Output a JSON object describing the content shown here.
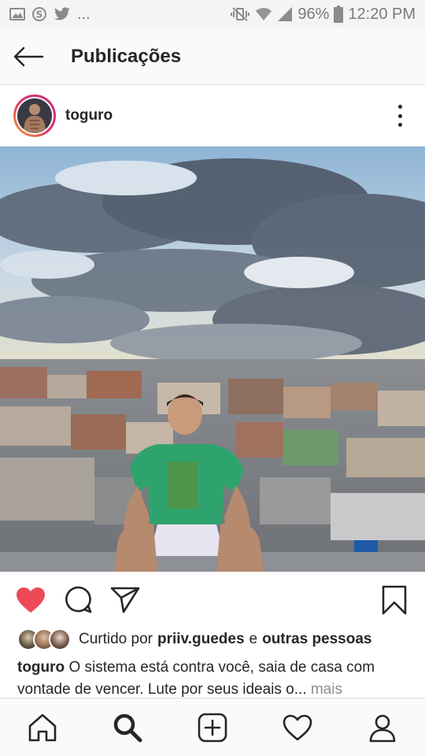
{
  "status_bar": {
    "notification_icons": [
      "image-icon",
      "skype-icon",
      "twitter-icon"
    ],
    "overflow_text": "...",
    "battery": "96%",
    "time": "12:20 PM"
  },
  "header": {
    "title": "Publicações"
  },
  "post": {
    "username": "toguro",
    "liked": true,
    "likes": {
      "prefix": "Curtido por",
      "user": "priiv.guedes",
      "conjunction": "e",
      "others": "outras pessoas"
    },
    "caption": {
      "username": "toguro",
      "text": "O sistema está contra você, saia de casa com vontade de vencer. Lute por seus ideais o...",
      "more": "mais"
    }
  },
  "colors": {
    "like_red": "#ed4956",
    "text": "#262626",
    "muted": "#8e8e8e"
  }
}
